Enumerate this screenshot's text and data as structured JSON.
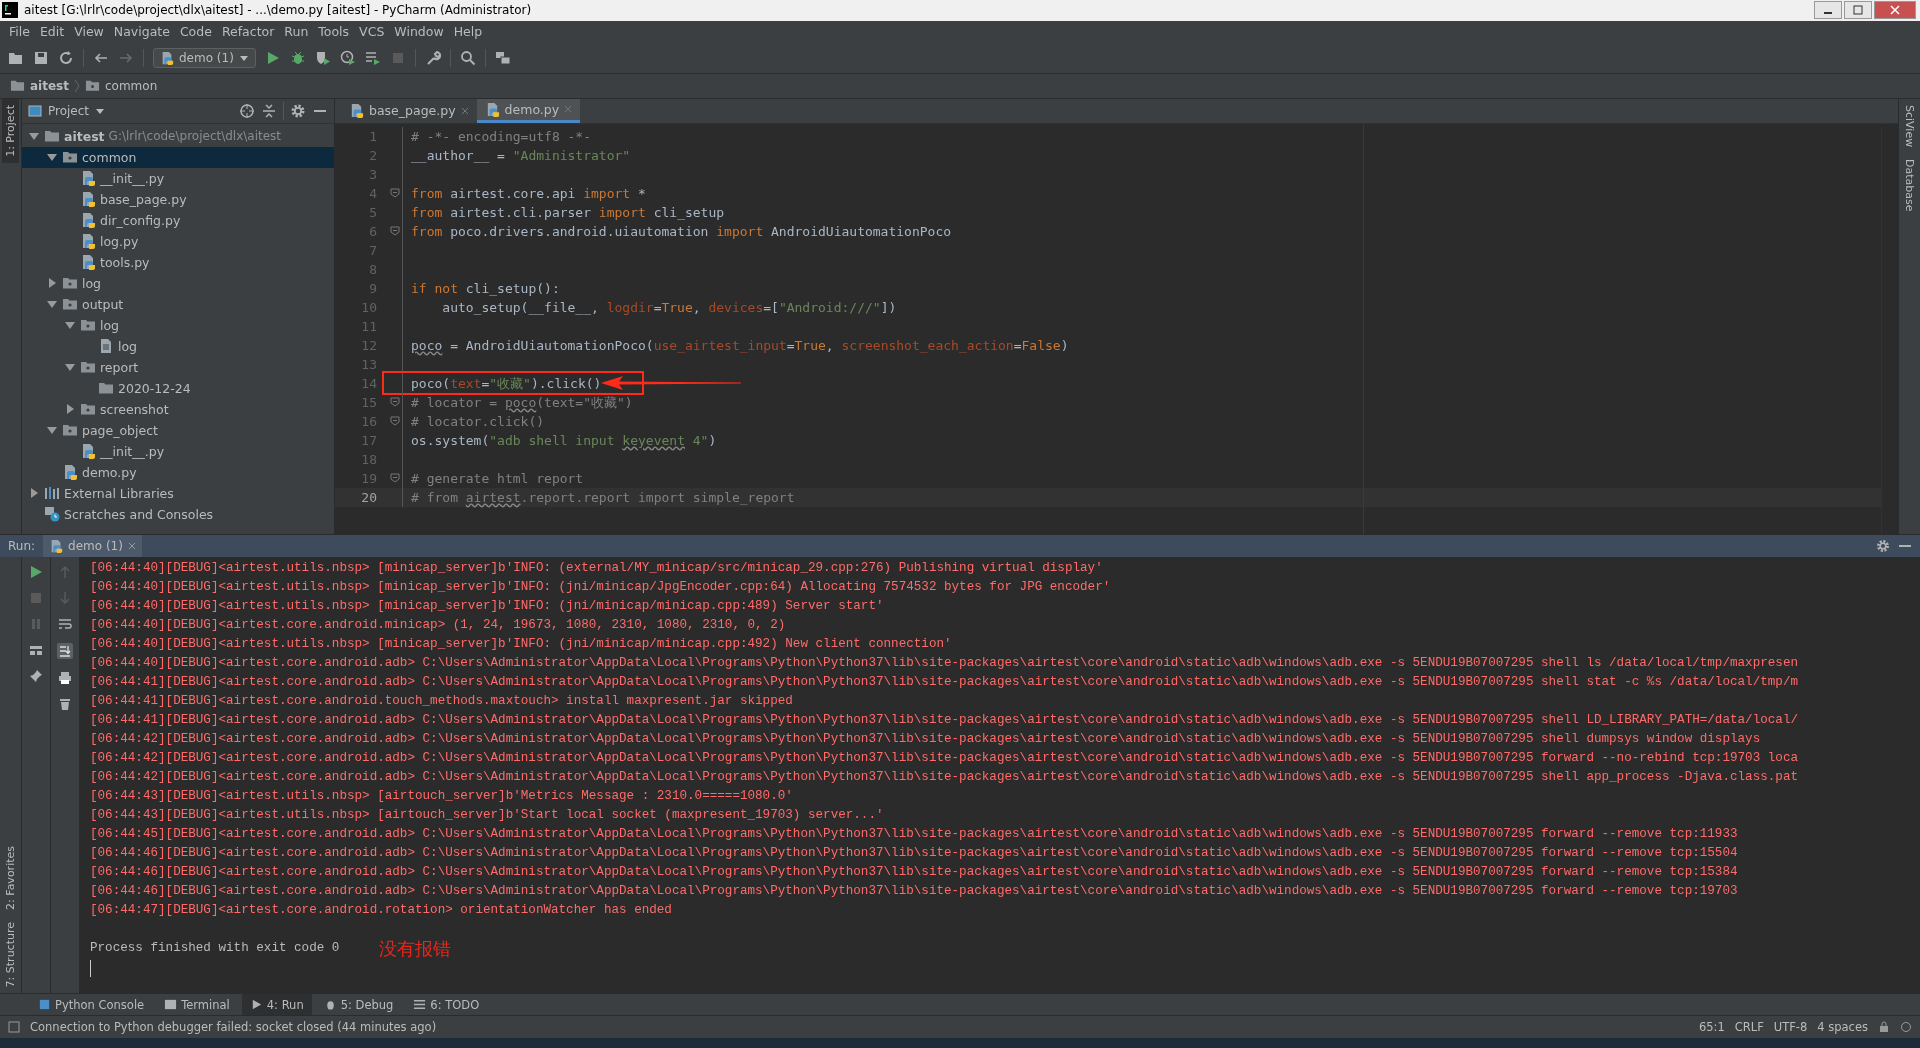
{
  "window": {
    "title": "aitest [G:\\lrlr\\code\\project\\dlx\\aitest] - ...\\demo.py [aitest] - PyCharm (Administrator)"
  },
  "menu": [
    "File",
    "Edit",
    "View",
    "Navigate",
    "Code",
    "Refactor",
    "Run",
    "Tools",
    "VCS",
    "Window",
    "Help"
  ],
  "toolbar": {
    "run_config": "demo (1)"
  },
  "breadcrumb": [
    "aitest",
    "common"
  ],
  "left_stripe": [
    "1: Project",
    "2: Favorites",
    "7: Structure"
  ],
  "right_stripe": [
    "SciView",
    "Database"
  ],
  "project": {
    "title": "Project",
    "tree": [
      {
        "label": "aitest",
        "path": "G:\\lrlr\\code\\project\\dlx\\aitest",
        "kind": "folder",
        "expanded": true,
        "selected": false,
        "children": [
          {
            "label": "common",
            "kind": "package",
            "expanded": true,
            "selected": true,
            "children": [
              {
                "label": "__init__.py",
                "kind": "python",
                "selected": false
              },
              {
                "label": "base_page.py",
                "kind": "python",
                "selected": false
              },
              {
                "label": "dir_config.py",
                "kind": "python",
                "selected": false
              },
              {
                "label": "log.py",
                "kind": "python",
                "selected": false
              },
              {
                "label": "tools.py",
                "kind": "python",
                "selected": false
              }
            ]
          },
          {
            "label": "log",
            "kind": "package",
            "expanded": false,
            "selected": false
          },
          {
            "label": "output",
            "kind": "package",
            "expanded": true,
            "selected": false,
            "children": [
              {
                "label": "log",
                "kind": "package",
                "expanded": true,
                "selected": false,
                "children": [
                  {
                    "label": "log",
                    "kind": "text",
                    "selected": false
                  }
                ]
              },
              {
                "label": "report",
                "kind": "package",
                "expanded": true,
                "selected": false,
                "children": [
                  {
                    "label": "2020-12-24",
                    "kind": "folder",
                    "selected": false
                  }
                ]
              },
              {
                "label": "screenshot",
                "kind": "package",
                "expanded": false,
                "selected": false
              }
            ]
          },
          {
            "label": "page_object",
            "kind": "package",
            "expanded": true,
            "selected": false,
            "children": [
              {
                "label": "__init__.py",
                "kind": "python",
                "selected": false
              }
            ]
          },
          {
            "label": "demo.py",
            "kind": "python",
            "selected": false
          }
        ]
      },
      {
        "label": "External Libraries",
        "kind": "libraries",
        "expanded": false,
        "selected": false
      },
      {
        "label": "Scratches and Consoles",
        "kind": "scratches",
        "selected": false
      }
    ]
  },
  "editor": {
    "tabs": [
      {
        "label": "base_page.py",
        "selected": false
      },
      {
        "label": "demo.py",
        "selected": true
      }
    ],
    "lines": [
      {
        "number": "1",
        "tokens": [
          {
            "text": "# -*- encoding=utf8 -*-",
            "kind": "comment"
          }
        ]
      },
      {
        "number": "2",
        "tokens": [
          {
            "text": "__author__ = ",
            "kind": "plain"
          },
          {
            "text": "\"Administrator\"",
            "kind": "string"
          }
        ]
      },
      {
        "number": "3"
      },
      {
        "number": "4",
        "fold": true,
        "tokens": [
          {
            "text": "from",
            "kind": "keyword"
          },
          {
            "text": " airtest.core.api ",
            "kind": "plain"
          },
          {
            "text": "import",
            "kind": "keyword"
          },
          {
            "text": " *",
            "kind": "plain"
          }
        ]
      },
      {
        "number": "5",
        "tokens": [
          {
            "text": "from",
            "kind": "keyword"
          },
          {
            "text": " airtest.cli.parser ",
            "kind": "plain"
          },
          {
            "text": "import",
            "kind": "keyword"
          },
          {
            "text": " cli_setup",
            "kind": "plain"
          }
        ]
      },
      {
        "number": "6",
        "fold": true,
        "tokens": [
          {
            "text": "from",
            "kind": "keyword"
          },
          {
            "text": " poco.drivers.android.uiautomation ",
            "kind": "plain"
          },
          {
            "text": "import",
            "kind": "keyword"
          },
          {
            "text": " AndroidUiautomationPoco",
            "kind": "plain"
          }
        ]
      },
      {
        "number": "7"
      },
      {
        "number": "8"
      },
      {
        "number": "9",
        "tokens": [
          {
            "text": "if not",
            "kind": "keyword"
          },
          {
            "text": " cli_setup():",
            "kind": "plain"
          }
        ]
      },
      {
        "number": "10",
        "tokens": [
          {
            "text": "    auto_setup(__file__, ",
            "kind": "plain"
          },
          {
            "text": "logdir",
            "kind": "param"
          },
          {
            "text": "=",
            "kind": "plain"
          },
          {
            "text": "True",
            "kind": "keyword"
          },
          {
            "text": ", ",
            "kind": "plain"
          },
          {
            "text": "devices",
            "kind": "param"
          },
          {
            "text": "=[",
            "kind": "plain"
          },
          {
            "text": "\"Android:///\"",
            "kind": "string"
          },
          {
            "text": "])",
            "kind": "plain"
          }
        ]
      },
      {
        "number": "11"
      },
      {
        "number": "12",
        "tokens": [
          {
            "text": "poco",
            "kind": "plain",
            "underlined": true
          },
          {
            "text": " = AndroidUiautomationPoco(",
            "kind": "plain"
          },
          {
            "text": "use_airtest_input",
            "kind": "param"
          },
          {
            "text": "=",
            "kind": "plain"
          },
          {
            "text": "True",
            "kind": "keyword"
          },
          {
            "text": ", ",
            "kind": "plain"
          },
          {
            "text": "screenshot_each_action",
            "kind": "param"
          },
          {
            "text": "=",
            "kind": "plain"
          },
          {
            "text": "False",
            "kind": "keyword"
          },
          {
            "text": ")",
            "kind": "plain"
          }
        ]
      },
      {
        "number": "13"
      },
      {
        "number": "14",
        "boxed": true,
        "tokens": [
          {
            "text": "poco(",
            "kind": "plain"
          },
          {
            "text": "text",
            "kind": "param"
          },
          {
            "text": "=",
            "kind": "plain"
          },
          {
            "text": "\"收藏\"",
            "kind": "string"
          },
          {
            "text": ").click()",
            "kind": "plain"
          }
        ]
      },
      {
        "number": "15",
        "fold": true,
        "tokens": [
          {
            "text": "# locator = ",
            "kind": "comment"
          },
          {
            "text": "poco",
            "kind": "comment",
            "underlined": true
          },
          {
            "text": "(text=\"收藏\")",
            "kind": "comment"
          }
        ]
      },
      {
        "number": "16",
        "fold": true,
        "tokens": [
          {
            "text": "# locator.click()",
            "kind": "comment"
          }
        ]
      },
      {
        "number": "17",
        "tokens": [
          {
            "text": "os.system(",
            "kind": "plain"
          },
          {
            "text": "\"adb shell input ",
            "kind": "string"
          },
          {
            "text": "keyevent",
            "kind": "string",
            "underlined": true
          },
          {
            "text": " 4\"",
            "kind": "string"
          },
          {
            "text": ")",
            "kind": "plain"
          }
        ]
      },
      {
        "number": "18"
      },
      {
        "number": "19",
        "fold": true,
        "tokens": [
          {
            "text": "# generate html report",
            "kind": "comment"
          }
        ]
      },
      {
        "number": "20",
        "current": true,
        "tokens": [
          {
            "text": "# from ",
            "kind": "comment"
          },
          {
            "text": "airtest",
            "kind": "comment",
            "underlined": true
          },
          {
            "text": ".report.report import simple_report",
            "kind": "comment"
          }
        ]
      }
    ]
  },
  "run": {
    "label": "Run:",
    "tab": "demo (1)",
    "log": [
      "[06:44:40][DEBUG]<airtest.utils.nbsp> [minicap_server]b'INFO: (external/MY_minicap/src/minicap_29.cpp:276) Publishing virtual display'",
      "[06:44:40][DEBUG]<airtest.utils.nbsp> [minicap_server]b'INFO: (jni/minicap/JpgEncoder.cpp:64) Allocating 7574532 bytes for JPG encoder'",
      "[06:44:40][DEBUG]<airtest.utils.nbsp> [minicap_server]b'INFO: (jni/minicap/minicap.cpp:489) Server start'",
      "[06:44:40][DEBUG]<airtest.core.android.minicap> (1, 24, 19673, 1080, 2310, 1080, 2310, 0, 2)",
      "[06:44:40][DEBUG]<airtest.utils.nbsp> [minicap_server]b'INFO: (jni/minicap/minicap.cpp:492) New client connection'",
      "[06:44:40][DEBUG]<airtest.core.android.adb> C:\\Users\\Administrator\\AppData\\Local\\Programs\\Python\\Python37\\lib\\site-packages\\airtest\\core\\android\\static\\adb\\windows\\adb.exe -s 5ENDU19B07007295 shell ls /data/local/tmp/maxpresen",
      "[06:44:41][DEBUG]<airtest.core.android.adb> C:\\Users\\Administrator\\AppData\\Local\\Programs\\Python\\Python37\\lib\\site-packages\\airtest\\core\\android\\static\\adb\\windows\\adb.exe -s 5ENDU19B07007295 shell stat -c %s /data/local/tmp/m",
      "[06:44:41][DEBUG]<airtest.core.android.touch_methods.maxtouch> install maxpresent.jar skipped",
      "[06:44:41][DEBUG]<airtest.core.android.adb> C:\\Users\\Administrator\\AppData\\Local\\Programs\\Python\\Python37\\lib\\site-packages\\airtest\\core\\android\\static\\adb\\windows\\adb.exe -s 5ENDU19B07007295 shell LD_LIBRARY_PATH=/data/local/",
      "[06:44:42][DEBUG]<airtest.core.android.adb> C:\\Users\\Administrator\\AppData\\Local\\Programs\\Python\\Python37\\lib\\site-packages\\airtest\\core\\android\\static\\adb\\windows\\adb.exe -s 5ENDU19B07007295 shell dumpsys window displays",
      "[06:44:42][DEBUG]<airtest.core.android.adb> C:\\Users\\Administrator\\AppData\\Local\\Programs\\Python\\Python37\\lib\\site-packages\\airtest\\core\\android\\static\\adb\\windows\\adb.exe -s 5ENDU19B07007295 forward --no-rebind tcp:19703 loca",
      "[06:44:42][DEBUG]<airtest.core.android.adb> C:\\Users\\Administrator\\AppData\\Local\\Programs\\Python\\Python37\\lib\\site-packages\\airtest\\core\\android\\static\\adb\\windows\\adb.exe -s 5ENDU19B07007295 shell app_process -Djava.class.pat",
      "[06:44:43][DEBUG]<airtest.utils.nbsp> [airtouch_server]b'Metrics Message : 2310.0=====1080.0'",
      "[06:44:43][DEBUG]<airtest.utils.nbsp> [airtouch_server]b'Start local socket (maxpresent_19703) server...'",
      "[06:44:45][DEBUG]<airtest.core.android.adb> C:\\Users\\Administrator\\AppData\\Local\\Programs\\Python\\Python37\\lib\\site-packages\\airtest\\core\\android\\static\\adb\\windows\\adb.exe -s 5ENDU19B07007295 forward --remove tcp:11933",
      "[06:44:46][DEBUG]<airtest.core.android.adb> C:\\Users\\Administrator\\AppData\\Local\\Programs\\Python\\Python37\\lib\\site-packages\\airtest\\core\\android\\static\\adb\\windows\\adb.exe -s 5ENDU19B07007295 forward --remove tcp:15504",
      "[06:44:46][DEBUG]<airtest.core.android.adb> C:\\Users\\Administrator\\AppData\\Local\\Programs\\Python\\Python37\\lib\\site-packages\\airtest\\core\\android\\static\\adb\\windows\\adb.exe -s 5ENDU19B07007295 forward --remove tcp:15384",
      "[06:44:46][DEBUG]<airtest.core.android.adb> C:\\Users\\Administrator\\AppData\\Local\\Programs\\Python\\Python37\\lib\\site-packages\\airtest\\core\\android\\static\\adb\\windows\\adb.exe -s 5ENDU19B07007295 forward --remove tcp:19703",
      "[06:44:47][DEBUG]<airtest.core.android.rotation> orientationWatcher has ended"
    ],
    "exit_line": "Process finished with exit code 0",
    "note": "没有报错"
  },
  "tool_windows": [
    {
      "label": "Python Console",
      "kind": "console",
      "selected": false
    },
    {
      "label": "Terminal",
      "kind": "terminal",
      "selected": false
    },
    {
      "label": "4: Run",
      "kind": "run",
      "selected": true
    },
    {
      "label": "5: Debug",
      "kind": "debug",
      "selected": false
    },
    {
      "label": "6: TODO",
      "kind": "todo",
      "selected": false
    }
  ],
  "status_bar": {
    "message": "Connection to Python debugger failed: socket closed (44 minutes ago)",
    "items": [
      "65:1",
      "CRLF",
      "UTF-8",
      "4 spaces"
    ]
  }
}
